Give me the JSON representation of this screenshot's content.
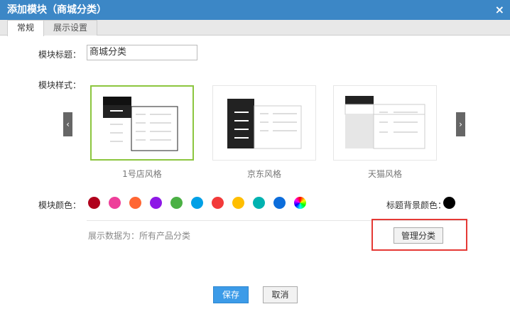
{
  "dialog": {
    "title": "添加模块（商城分类）",
    "close_icon": "×"
  },
  "tabs": [
    {
      "label": "常规",
      "active": true
    },
    {
      "label": "展示设置",
      "active": false
    }
  ],
  "form": {
    "title_label": "模块标题：",
    "title_value": "商城分类",
    "style_label": "模块样式：",
    "styles": [
      {
        "name": "1号店风格",
        "selected": true
      },
      {
        "name": "京东风格",
        "selected": false
      },
      {
        "name": "天猫风格",
        "selected": false
      }
    ],
    "color_label": "模块颜色：",
    "colors": [
      "#b0001c",
      "#ee3f9a",
      "#ff6633",
      "#8e18e6",
      "#4bb044",
      "#00a0e6",
      "#f23a3a",
      "#ffbe00",
      "#00b2b0",
      "#0c6ddb",
      "rainbow"
    ],
    "title_bg_label": "标题背景颜色：",
    "title_bg_color": "#000000",
    "data_text": "展示数据为：所有产品分类",
    "manage_button": "管理分类"
  },
  "footer": {
    "save": "保存",
    "cancel": "取消"
  }
}
